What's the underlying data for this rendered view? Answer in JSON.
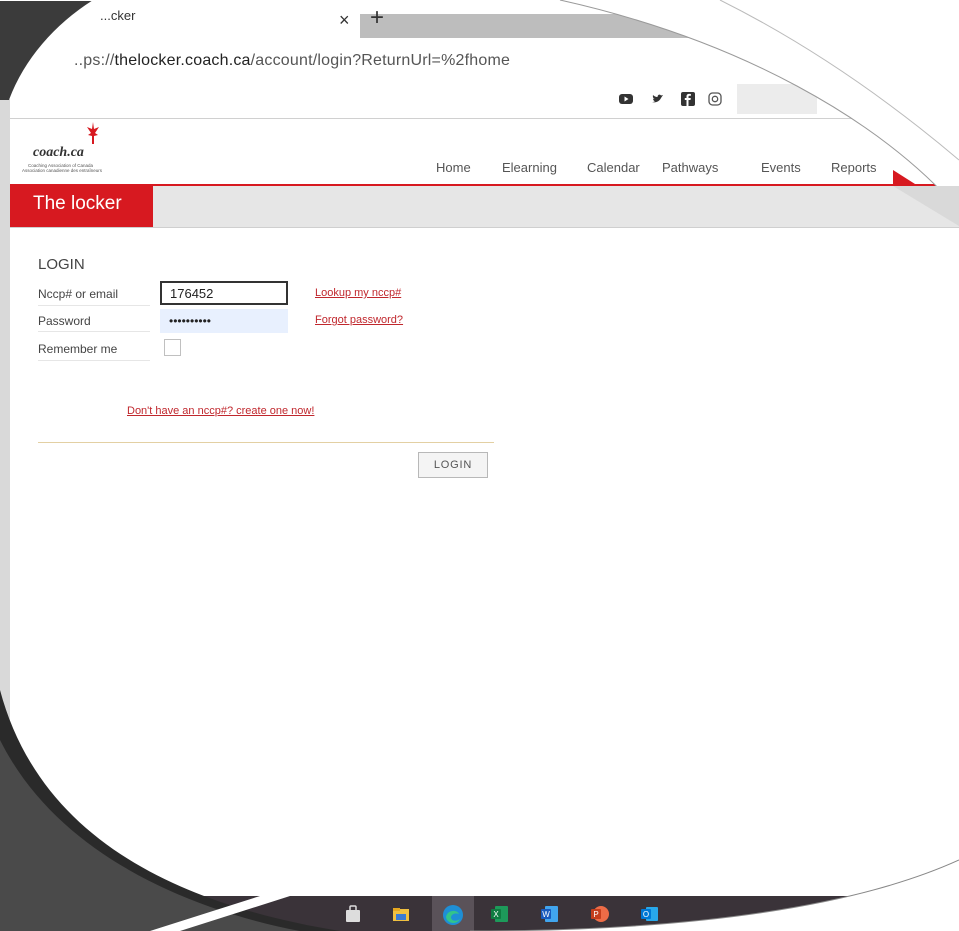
{
  "browser": {
    "tab_title": "...cker",
    "url_prefix": "..ps://",
    "url_host": "thelocker.coach.ca",
    "url_path": "/account/login?ReturnUrl=%2fhome"
  },
  "site": {
    "logo_text": "coach.ca",
    "logo_sub1": "Coaching Association of Canada",
    "logo_sub2": "Association canadienne des entraîneurs",
    "section_title": "The locker",
    "nav": [
      "Home",
      "Elearning",
      "Calendar",
      "Pathways",
      "Events",
      "Reports"
    ],
    "social_icons": [
      "youtube-icon",
      "twitter-icon",
      "facebook-icon",
      "instagram-icon"
    ]
  },
  "login": {
    "heading": "LOGIN",
    "nccp_label": "Nccp# or email",
    "nccp_value": "176452",
    "password_label": "Password",
    "password_value": "••••••••••",
    "remember_label": "Remember me",
    "lookup_link": "Lookup my nccp#",
    "forgot_link": "Forgot password?",
    "signup_link": "Don't have an nccp#? create one now!",
    "button_label": "LOGIN"
  },
  "taskbar": {
    "apps": [
      "store-icon",
      "file-explorer-icon",
      "edge-icon",
      "excel-icon",
      "word-icon",
      "powerpoint-icon",
      "outlook-icon"
    ]
  },
  "colors": {
    "brand_red": "#d71920",
    "link_red": "#c0272d"
  }
}
